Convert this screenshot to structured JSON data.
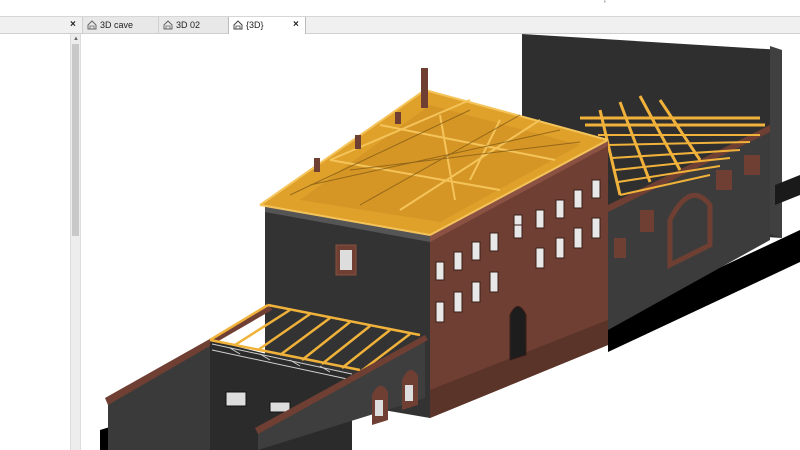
{
  "topbar": {
    "marker": "'"
  },
  "tabs": {
    "blank": {
      "label": "",
      "close": "×"
    },
    "cave": {
      "label": "3D cave",
      "icon": "home-3d-icon"
    },
    "view02": {
      "label": "3D 02",
      "icon": "home-3d-icon"
    },
    "active": {
      "label": "{3D}",
      "icon": "home-3d-icon",
      "close": "×"
    }
  },
  "scrollbar": {
    "up": "▲"
  },
  "viewport": {
    "model": "3d-building-model"
  },
  "colors": {
    "brick": "#6e3f32",
    "brickDark": "#5a3329",
    "wallDark": "#3b3b3b",
    "wallLight": "#505050",
    "roofWood": "#e0a12b",
    "timber": "#f0b23a",
    "slab": "#000000"
  }
}
